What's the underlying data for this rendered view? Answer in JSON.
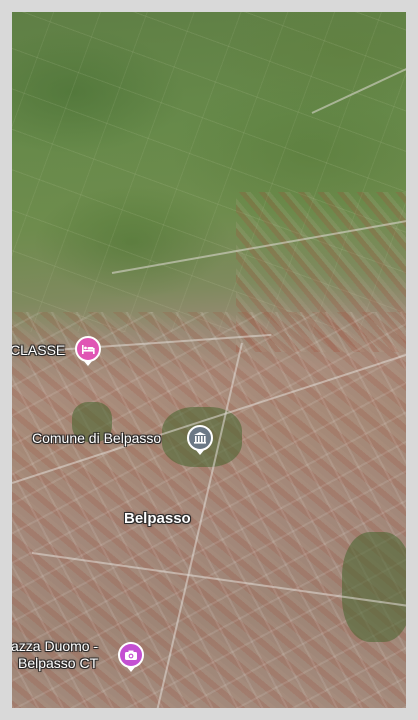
{
  "map": {
    "view": "satellite-3d",
    "places": [
      {
        "id": "hotel",
        "name": "CLASSE",
        "icon": "bed-icon",
        "color": "#e055b4"
      },
      {
        "id": "townhall",
        "name": "Comune di Belpasso",
        "icon": "government-building-icon",
        "color": "#6b7885"
      },
      {
        "id": "city",
        "name": "Belpasso"
      },
      {
        "id": "square",
        "name_line1": "azza Duomo -",
        "name_line2": "Belpasso CT",
        "icon": "camera-icon",
        "color": "#c34fd2"
      }
    ]
  }
}
